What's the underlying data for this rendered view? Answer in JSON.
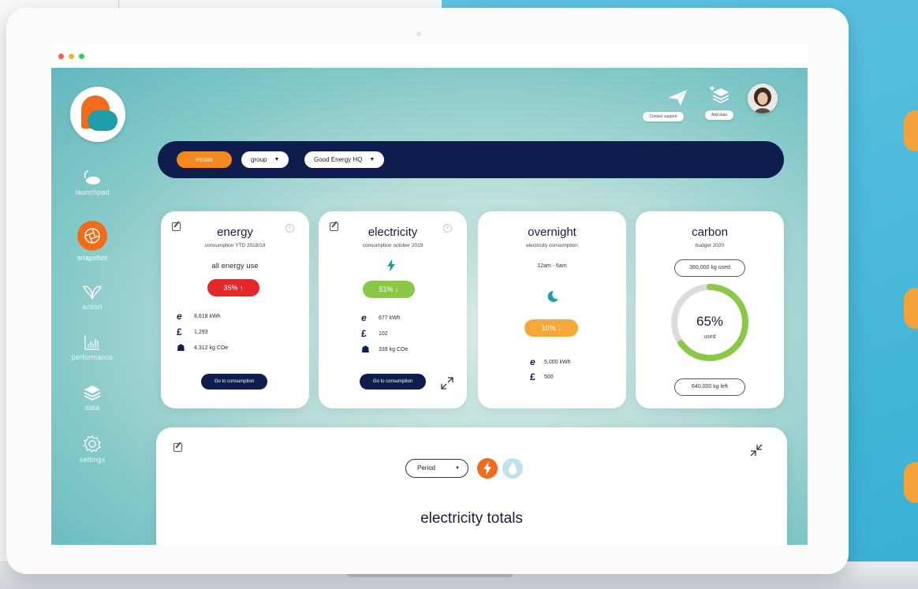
{
  "browser": {
    "dots": [
      "#f25f4c",
      "#f4b33c",
      "#3ec56b"
    ]
  },
  "sidebar": {
    "items": [
      {
        "label": "launchpad",
        "icon": "launchpad-icon"
      },
      {
        "label": "snapshot",
        "icon": "aperture-icon",
        "active": true
      },
      {
        "label": "action",
        "icon": "leaf-icon"
      },
      {
        "label": "performance",
        "icon": "bar-chart-icon"
      },
      {
        "label": "data",
        "icon": "layers-icon"
      },
      {
        "label": "settings",
        "icon": "gear-icon"
      }
    ]
  },
  "header": {
    "contact_support": "Contact support",
    "add_data": "Add data"
  },
  "filters": {
    "estate": "estate",
    "group": "group",
    "site": "Good Energy HQ"
  },
  "cards": {
    "energy": {
      "title": "energy",
      "subtitle": "consumption YTD 2018/19",
      "caption": "all energy use",
      "badge": "35% ↑",
      "kwh": "8,618 kWh",
      "cost": "1,293",
      "co2": "4,312 kg COe",
      "button": "Go to consumption"
    },
    "electricity": {
      "title": "electricity",
      "subtitle": "consumption october 2019",
      "badge": "51% ↓",
      "kwh": "677 kWh",
      "cost": "102",
      "co2": "339 kg COe",
      "button": "Go to consumption"
    },
    "overnight": {
      "title": "overnight",
      "subtitle": "electricity consumption",
      "time": "12am - 6am",
      "badge": "10% ↓",
      "kwh": "5,000 kWh",
      "cost": "500"
    },
    "carbon": {
      "title": "carbon",
      "subtitle": "budget 2020",
      "used_pill": "360,000 kg used",
      "percent": "65%",
      "percent_label": "used",
      "left_pill": "640,000 kg left",
      "used_fraction": 0.65
    }
  },
  "panel": {
    "period": "Period",
    "title": "electricity totals"
  },
  "colors": {
    "navy": "#0e1c4e",
    "orange": "#f28a1f",
    "red": "#e5262b",
    "green": "#8bc848",
    "amber": "#f6a73a",
    "teal": "#1f9dab"
  }
}
